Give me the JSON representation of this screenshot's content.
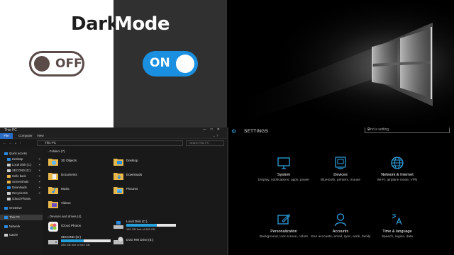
{
  "banner": {
    "title_dark_part": "Dark",
    "title_mode_part": "Mode",
    "toggle_off_label": "OFF",
    "toggle_on_label": "ON",
    "accent": "#1a8fe0"
  },
  "explorer": {
    "window_title": "This PC",
    "ribbon_tabs": [
      "File",
      "Computer",
      "View"
    ],
    "address": "This PC",
    "search_placeholder": "Search This PC",
    "sidebar": [
      {
        "label": "Quick access",
        "icon": "star-icon",
        "color": "#2a8be0",
        "pinned": false
      },
      {
        "label": "Desktop",
        "icon": "desktop-icon",
        "color": "#2a8be0",
        "pinned": true
      },
      {
        "label": "Local Disk (C:)",
        "icon": "drive-icon",
        "color": "#cfcfcf",
        "pinned": true
      },
      {
        "label": "SECOND (D:)",
        "icon": "drive-icon",
        "color": "#cfcfcf",
        "pinned": true
      },
      {
        "label": "Hello back",
        "icon": "folder-icon",
        "color": "#e8b84a",
        "pinned": true
      },
      {
        "label": "Screenshots",
        "icon": "folder-icon",
        "color": "#e8b84a",
        "pinned": true
      },
      {
        "label": "Downloads",
        "icon": "download-icon",
        "color": "#2a8be0",
        "pinned": true
      },
      {
        "label": "Recycle Bin",
        "icon": "recycle-bin-icon",
        "color": "#cfcfcf",
        "pinned": true
      },
      {
        "label": "iCloud Photos",
        "icon": "cloud-icon",
        "color": "#cfcfcf",
        "pinned": false
      },
      {
        "label": "OneDrive",
        "icon": "onedrive-icon",
        "color": "#2a8be0",
        "pinned": false
      },
      {
        "label": "This PC",
        "icon": "pc-icon",
        "color": "#2a8be0",
        "pinned": false,
        "selected": true
      },
      {
        "label": "Network",
        "icon": "network-icon",
        "color": "#2a8be0",
        "pinned": false
      },
      {
        "label": "Catch!",
        "icon": "catch-icon",
        "color": "#cfcfcf",
        "pinned": false
      }
    ],
    "folders_header": "Folders (7)",
    "folders": [
      {
        "label": "3D Objects",
        "icon": "3d-objects-folder-icon"
      },
      {
        "label": "Desktop",
        "icon": "desktop-folder-icon"
      },
      {
        "label": "Documents",
        "icon": "documents-folder-icon"
      },
      {
        "label": "Downloads",
        "icon": "downloads-folder-icon"
      },
      {
        "label": "Music",
        "icon": "music-folder-icon"
      },
      {
        "label": "Pictures",
        "icon": "pictures-folder-icon"
      },
      {
        "label": "Videos",
        "icon": "videos-folder-icon"
      }
    ],
    "devices_header": "Devices and drives (4)",
    "drives": [
      {
        "label": "iCloud Photos",
        "icon": "icloud-photos-icon",
        "has_bar": false
      },
      {
        "label": "Local Disk (C:)",
        "icon": "local-disk-icon",
        "has_bar": true,
        "used_fraction": 0.62,
        "free_text": "182 GB free of 465 GB"
      },
      {
        "label": "SECOND (D:)",
        "icon": "drive-icon",
        "has_bar": true,
        "used_fraction": 0.45,
        "free_text": "280 GB free of 510 GB"
      },
      {
        "label": "DVD RW Drive (E:)",
        "icon": "dvd-drive-icon",
        "has_bar": false
      }
    ]
  },
  "settings": {
    "title": "SETTINGS",
    "search_placeholder": "Find a setting",
    "accent": "#2ea1e0",
    "items": [
      {
        "name": "System",
        "desc": "Display, notifications, apps, power",
        "icon": "monitor-icon"
      },
      {
        "name": "Devices",
        "desc": "Bluetooth, printers, mouse",
        "icon": "devices-icon"
      },
      {
        "name": "Network & Internet",
        "desc": "Wi-Fi, airplane mode, VPN",
        "icon": "globe-icon"
      },
      {
        "name": "Personalization",
        "desc": "Background, lock screen, colors",
        "icon": "paint-icon"
      },
      {
        "name": "Accounts",
        "desc": "Your accounts, email, sync, work, family",
        "icon": "person-icon"
      },
      {
        "name": "Time & language",
        "desc": "Speech, region, date",
        "icon": "time-language-icon"
      }
    ]
  }
}
